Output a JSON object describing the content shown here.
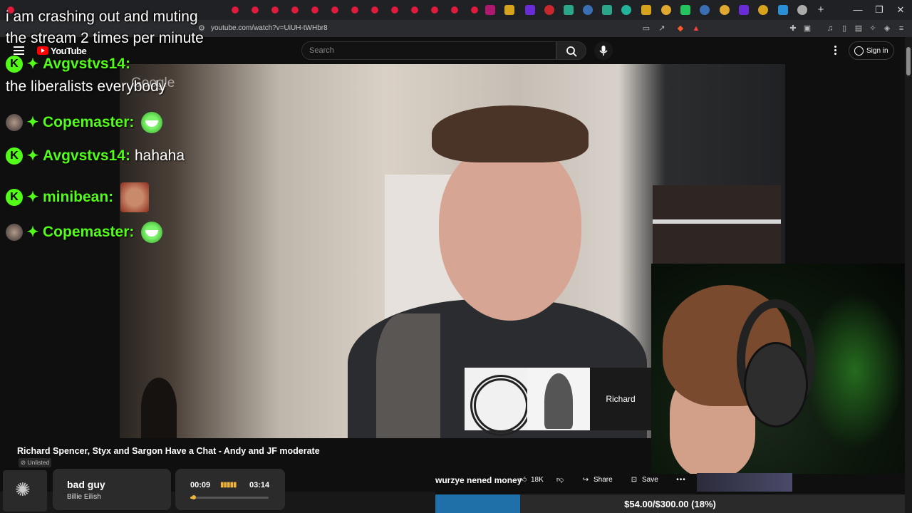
{
  "browser": {
    "url": "youtube.com/watch?v=UiUH-tWHbr8",
    "win_minimize": "—",
    "win_restore": "❐",
    "win_close": "✕",
    "new_tab": "+"
  },
  "youtube": {
    "wordmark": "YouTube",
    "search_placeholder": "Search",
    "signin_label": "Sign in",
    "video_title": "Richard Spencer, Styx and Sargon Have a Chat - Andy and JF moderate",
    "visibility": "Unlisted",
    "likes": "18K",
    "share_label": "Share",
    "save_label": "Save",
    "more_label": "•••",
    "watermark": "Google",
    "participant_name": "Richard"
  },
  "overlay": {
    "banner_line1": "i am crashing out and muting",
    "banner_line2": "the stream 2 times per minute",
    "chat": [
      {
        "user": "Avgvstvs14:",
        "badge": "k-badge",
        "text": ""
      },
      {
        "user": "",
        "badge": "",
        "text": "the liberalists everybody"
      },
      {
        "user": "Copemaster:",
        "badge": "avatar-badge",
        "text": "",
        "emote": "laughing-emote"
      },
      {
        "user": "Avgvstvs14:",
        "badge": "k-badge",
        "text": "hahaha"
      },
      {
        "user": "minibean:",
        "badge": "k-badge",
        "text": "",
        "emote": "face-emote"
      },
      {
        "user": "Copemaster:",
        "badge": "avatar-badge",
        "text": "",
        "emote": "laughing-emote"
      }
    ],
    "k_glyph": "K",
    "diamond_glyph": "✦"
  },
  "now_playing": {
    "song": "bad guy",
    "artist": "Billie Eilish",
    "elapsed": "00:09",
    "duration": "03:14",
    "eq": "▮▮▮▮▮",
    "progress": 0.046
  },
  "ticker": {
    "text": "wurzye nened money"
  },
  "donation_goal": {
    "label": "$54.00/$300.00 (18%)",
    "progress": 0.18
  },
  "colors": {
    "kick_green": "#53fc18",
    "yt_red": "#ff0000",
    "goal_blue": "#1f6fa8",
    "spotify_accent": "#f0b43c"
  }
}
